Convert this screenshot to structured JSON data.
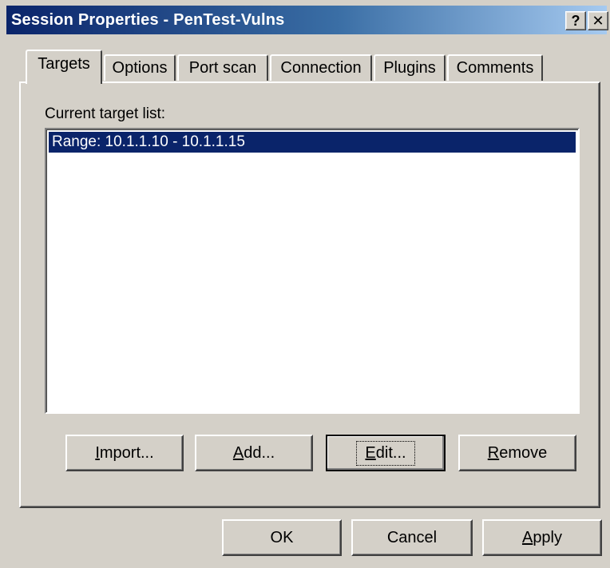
{
  "window": {
    "title": "Session Properties - PenTest-Vulns",
    "help_label": "?",
    "close_label": "✕"
  },
  "tabs": [
    {
      "label": "Targets",
      "active": true
    },
    {
      "label": "Options"
    },
    {
      "label": "Port scan"
    },
    {
      "label": "Connection"
    },
    {
      "label": "Plugins"
    },
    {
      "label": "Comments"
    }
  ],
  "targets": {
    "list_label": "Current target list:",
    "items": [
      {
        "label": "Range: 10.1.1.10 - 10.1.1.15",
        "selected": true
      }
    ]
  },
  "buttons": {
    "import": {
      "first": "I",
      "rest": "mport..."
    },
    "add": {
      "first": "A",
      "rest": "dd..."
    },
    "edit": {
      "first": "E",
      "rest": "dit..."
    },
    "remove": {
      "first": "R",
      "rest": "emove"
    },
    "ok": "OK",
    "cancel": "Cancel",
    "apply": {
      "first": "A",
      "rest": "pply"
    }
  },
  "colors": {
    "face": "#d4d0c8",
    "title_start": "#0a246a",
    "title_end": "#a6caf0",
    "selection": "#0a246a"
  }
}
